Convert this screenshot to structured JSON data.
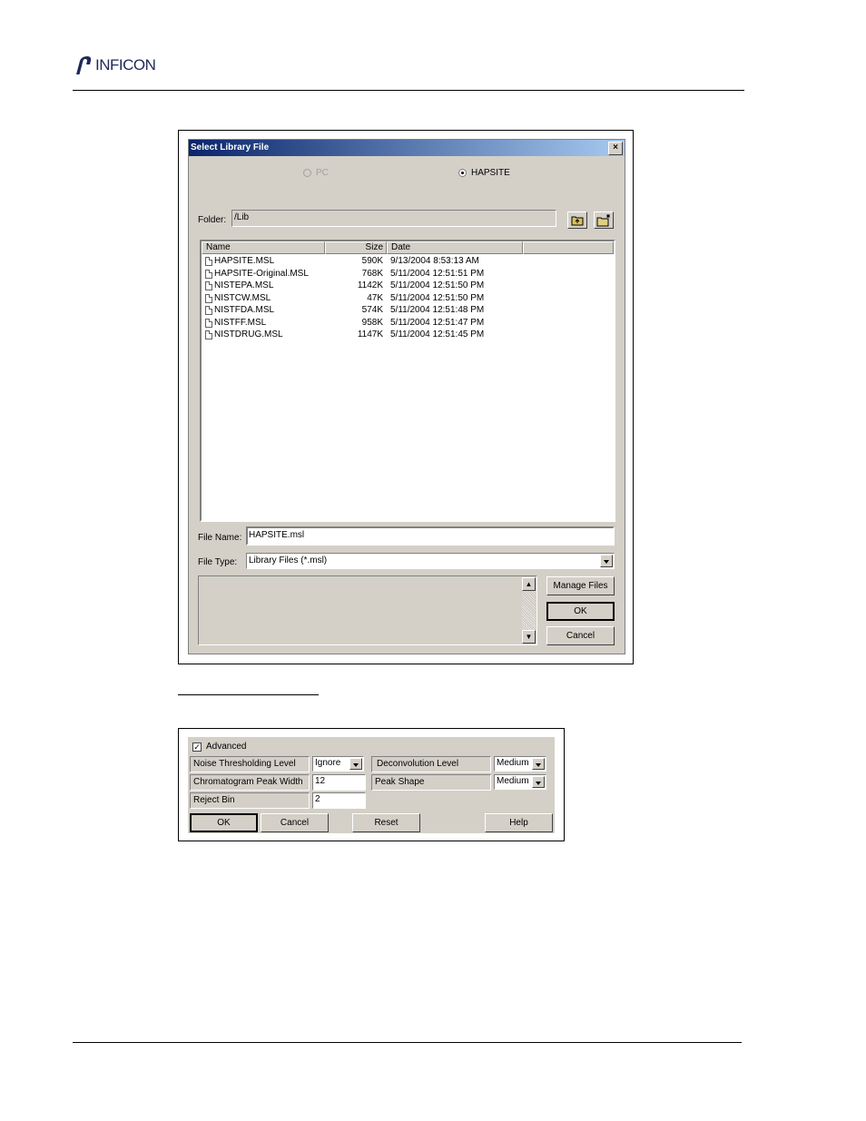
{
  "header": {
    "brand": "INFICON"
  },
  "select_dialog": {
    "title": "Select Library File",
    "close": "×",
    "radio_pc": "PC",
    "radio_hapsite": "HAPSITE",
    "selected_source": "HAPSITE",
    "folder_label": "Folder:",
    "folder_value": "/Lib",
    "columns": {
      "name": "Name",
      "size": "Size",
      "date": "Date"
    },
    "files": [
      {
        "name": "HAPSITE.MSL",
        "size": "590K",
        "date": "9/13/2004 8:53:13 AM"
      },
      {
        "name": "HAPSITE-Original.MSL",
        "size": "768K",
        "date": "5/11/2004 12:51:51 PM"
      },
      {
        "name": "NISTEPA.MSL",
        "size": "1142K",
        "date": "5/11/2004 12:51:50 PM"
      },
      {
        "name": "NISTCW.MSL",
        "size": "47K",
        "date": "5/11/2004 12:51:50 PM"
      },
      {
        "name": "NISTFDA.MSL",
        "size": "574K",
        "date": "5/11/2004 12:51:48 PM"
      },
      {
        "name": "NISTFF.MSL",
        "size": "958K",
        "date": "5/11/2004 12:51:47 PM"
      },
      {
        "name": "NISTDRUG.MSL",
        "size": "1147K",
        "date": "5/11/2004 12:51:45 PM"
      }
    ],
    "file_name_label": "File Name:",
    "file_name_value": "HAPSITE.msl",
    "file_type_label": "File Type:",
    "file_type_value": "Library Files (*.msl)",
    "manage_files": "Manage Files",
    "ok": "OK",
    "cancel": "Cancel"
  },
  "advanced_panel": {
    "advanced_label": "Advanced",
    "advanced_checked": true,
    "check_mark": "✓",
    "noise_label": "Noise Thresholding Level",
    "noise_value": "Ignore",
    "deconv_label": "Deconvolution Level",
    "deconv_value": "Medium",
    "peak_width_label": "Chromatogram Peak Width",
    "peak_width_value": "12",
    "peak_shape_label": "Peak Shape",
    "peak_shape_value": "Medium",
    "reject_bin_label": "Reject Bin",
    "reject_bin_value": "2",
    "ok": "OK",
    "cancel": "Cancel",
    "reset": "Reset",
    "help": "Help"
  },
  "colors": {
    "titlebar_start": "#0a246a",
    "titlebar_end": "#a6caf0",
    "dialog_face": "#d4d0c8",
    "brand": "#1f2a5a"
  }
}
